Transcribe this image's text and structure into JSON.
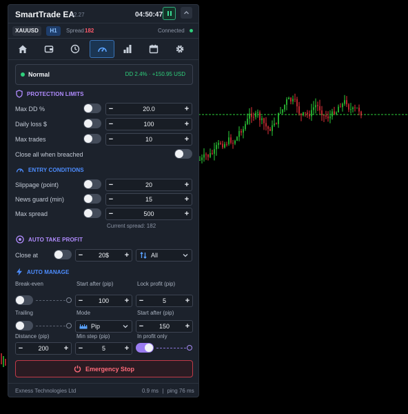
{
  "header": {
    "title": "SmartTrade EA",
    "version": "v2.27",
    "clock": "04:50:47",
    "pause_icon": "pause-icon",
    "collapse_icon": "chevron-up-icon"
  },
  "market": {
    "symbol": "XAUUSD",
    "timeframe": "H1",
    "spread_label": "Spread",
    "spread_value": "182",
    "connection": "Connected"
  },
  "tabs": [
    {
      "icon": "home-icon",
      "active": false
    },
    {
      "icon": "wallet-icon",
      "active": false
    },
    {
      "icon": "clock-icon",
      "active": false
    },
    {
      "icon": "gauge-icon",
      "active": true
    },
    {
      "icon": "bar-chart-icon",
      "active": false
    },
    {
      "icon": "calendar-icon",
      "active": false
    },
    {
      "icon": "gear-icon",
      "active": false
    }
  ],
  "status": {
    "state": "Normal",
    "dd_text": "DD 2.4% · +150.95 USD"
  },
  "protection": {
    "title": "PROTECTION LIMITS",
    "rows": [
      {
        "label": "Max DD %",
        "value": "20.0",
        "on": false
      },
      {
        "label": "Daily loss $",
        "value": "100",
        "on": false
      },
      {
        "label": "Max trades",
        "value": "10",
        "on": false
      }
    ],
    "close_all_label": "Close all when breached",
    "close_all_on": false
  },
  "entry": {
    "title": "ENTRY CONDITIONS",
    "rows": [
      {
        "label": "Slippage (point)",
        "value": "20",
        "on": false
      },
      {
        "label": "News guard (min)",
        "value": "15",
        "on": false
      },
      {
        "label": "Max spread",
        "value": "500",
        "on": false
      }
    ],
    "current_spread": "Current spread: 182"
  },
  "take_profit": {
    "title": "AUTO TAKE PROFIT",
    "close_at_label": "Close at",
    "close_at_value": "20$",
    "scope": "All",
    "on": false
  },
  "manage": {
    "title": "AUTO MANAGE",
    "break_even_label": "Break-even",
    "start_after_label": "Start after (pip)",
    "start_after_value": "100",
    "lock_profit_label": "Lock profit (pip)",
    "lock_profit_value": "5",
    "trailing_label": "Trailing",
    "mode_label": "Mode",
    "mode_value": "Pip",
    "trail_start_label": "Start after (pip)",
    "trail_start_value": "150",
    "distance_label": "Distance (pip)",
    "distance_value": "200",
    "min_step_label": "Min step (pip)",
    "min_step_value": "5",
    "in_profit_label": "In profit only",
    "in_profit_on": true
  },
  "emergency_label": "Emergency Stop",
  "footer": {
    "broker": "Exness Technologies Ltd",
    "latency": "0.9 ms",
    "ping": "ping 76 ms"
  },
  "colors": {
    "accent_purple": "#9a7cf0",
    "accent_blue": "#4d8dff",
    "status_green": "#2fd07c",
    "danger_red": "#ff5a6b",
    "candle_up": "#2ed13a",
    "candle_down": "#e8323c"
  }
}
